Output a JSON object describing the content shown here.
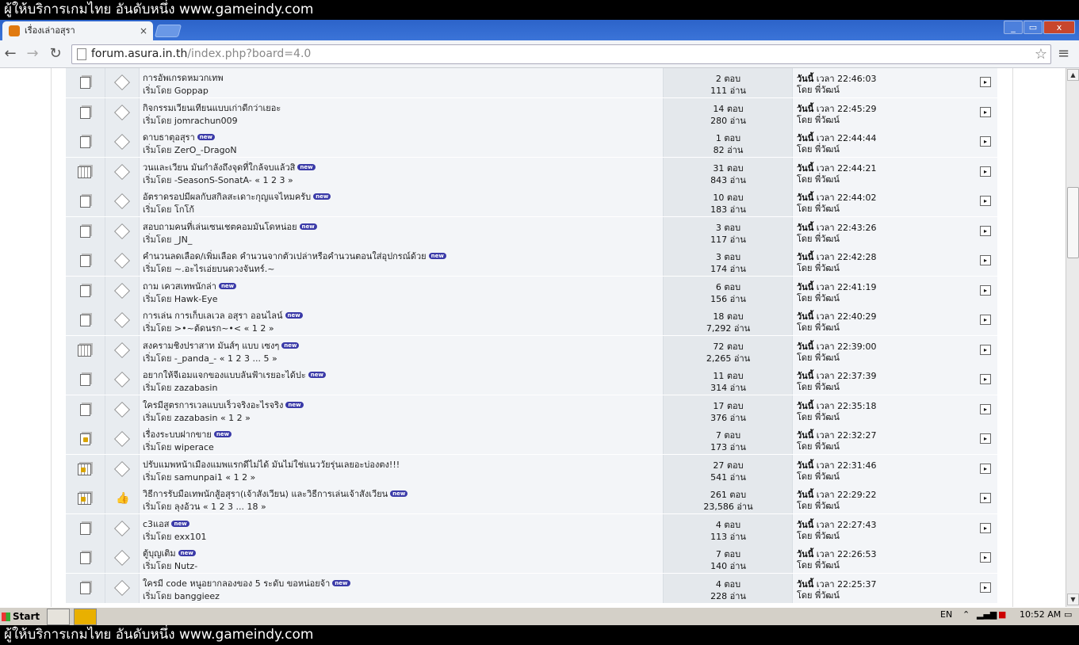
{
  "watermark": {
    "text": "ผู้ให้บริการเกมไทย อันดับหนึ่ง www.gameindy.com"
  },
  "browser": {
    "tab_title": "เรื่องเล่าอสุรา",
    "tab_close": "×",
    "url_host": "forum.asura.in.th",
    "url_path": "/index.php?board=4.0",
    "win_min": "_",
    "win_max": "▭",
    "win_close": "x"
  },
  "colors": {
    "titlebar": "#2c63c9",
    "new_badge": "#3a3aa8"
  },
  "topics": [
    {
      "icon": "normal",
      "mood": "diamond",
      "subject": "การอัพเกรดหมวกเทพ",
      "new": false,
      "starter": "Goppap",
      "pages": "",
      "replies": "2 ตอบ",
      "views": "111 อ่าน",
      "last_time": "22:46:03"
    },
    {
      "icon": "normal",
      "mood": "diamond",
      "subject": "กิจกรรมเวียนเทียนแบบเก่าดีกว่าเยอะ",
      "new": false,
      "starter": "jomrachun009",
      "pages": "",
      "replies": "14 ตอบ",
      "views": "280 อ่าน",
      "last_time": "22:45:29"
    },
    {
      "icon": "normal",
      "mood": "diamond",
      "subject": "ดาบธาตุอสุรา",
      "new": true,
      "starter": "ZerO_-DragoN",
      "pages": "",
      "replies": "1 ตอบ",
      "views": "82 อ่าน",
      "last_time": "22:44:44"
    },
    {
      "icon": "hot",
      "mood": "diamond",
      "subject": "วนและเวียน มันกำลังถึงจุดที่ใกล้จบแล้วสิ",
      "new": true,
      "starter": "-SeasonS-SonatA-",
      "pages": "« 1 2 3 »",
      "replies": "31 ตอบ",
      "views": "843 อ่าน",
      "last_time": "22:44:21"
    },
    {
      "icon": "normal",
      "mood": "diamond",
      "subject": "อัตราดรอปมีผลกับสกิลสะเดาะกุญแจไหมครับ",
      "new": true,
      "starter": "โกโก้",
      "pages": "",
      "replies": "10 ตอบ",
      "views": "183 อ่าน",
      "last_time": "22:44:02"
    },
    {
      "icon": "normal",
      "mood": "diamond",
      "subject": "สอบถามคนที่เล่นเซนเชตคอมมันโดหน่อย",
      "new": true,
      "starter": "_JN_",
      "pages": "",
      "replies": "3 ตอบ",
      "views": "117 อ่าน",
      "last_time": "22:43:26"
    },
    {
      "icon": "normal",
      "mood": "diamond",
      "subject": "คำนวนลดเลือด/เพิ่มเลือด คำนวนจากตัวเปล่าหรือคำนวนตอนใส่อุปกรณ์ด้วย",
      "new": true,
      "starter": "~.อะไรเอ่ยบนดวงจันทร์.~",
      "pages": "",
      "replies": "3 ตอบ",
      "views": "174 อ่าน",
      "last_time": "22:42:28"
    },
    {
      "icon": "normal",
      "mood": "diamond",
      "subject": "ถาม เควสเทพนักล่า",
      "new": true,
      "starter": "Hawk-Eye",
      "pages": "",
      "replies": "6 ตอบ",
      "views": "156 อ่าน",
      "last_time": "22:41:19"
    },
    {
      "icon": "normal",
      "mood": "diamond",
      "subject": "การเล่น การเก็บเลเวล อสุรา ออนไลน์",
      "new": true,
      "starter": ">•~ต้ดนรก~•<",
      "pages": "« 1 2 »",
      "replies": "18 ตอบ",
      "views": "7,292 อ่าน",
      "last_time": "22:40:29"
    },
    {
      "icon": "hot",
      "mood": "diamond",
      "subject": "สงครามชิงปราสาท มันส์ๆ แบบ เซงๆ",
      "new": true,
      "starter": "-_panda_-",
      "pages": "« 1 2 3 ... 5 »",
      "replies": "72 ตอบ",
      "views": "2,265 อ่าน",
      "last_time": "22:39:00"
    },
    {
      "icon": "normal",
      "mood": "diamond",
      "subject": "อยากให้จีเอมแจกของแบบลันฟ้าเรยอะได้ปะ",
      "new": true,
      "starter": "zazabasin",
      "pages": "",
      "replies": "11 ตอบ",
      "views": "314 อ่าน",
      "last_time": "22:37:39"
    },
    {
      "icon": "normal",
      "mood": "diamond",
      "subject": "ใครมีสูตรการเวลแบบเร็วจริงอะไรจริง",
      "new": true,
      "starter": "zazabasin",
      "pages": "« 1 2 »",
      "replies": "17 ตอบ",
      "views": "376 อ่าน",
      "last_time": "22:35:18"
    },
    {
      "icon": "lock",
      "mood": "diamond",
      "subject": "เรื่องระบบฝากขาย",
      "new": true,
      "starter": "wiperace",
      "pages": "",
      "replies": "7 ตอบ",
      "views": "173 อ่าน",
      "last_time": "22:32:27"
    },
    {
      "icon": "hotlock",
      "mood": "diamond",
      "subject": "ปรับแมพหน้าเมืองแมพแรกดีไม่ได้ มันไม่ใช่แนววัยรุ่นเลยอะบ่องตง!!!",
      "new": false,
      "starter": "samunpai1",
      "pages": "« 1 2 »",
      "replies": "27 ตอบ",
      "views": "541 อ่าน",
      "last_time": "22:31:46"
    },
    {
      "icon": "hotlock",
      "mood": "thumb",
      "subject": "วิธีการรับมือเทพนักสู้อสุรา(เจ้าสังเวียน) และวิธีการเล่นเจ้าสังเวียน",
      "new": true,
      "starter": "ลุงอ้วน",
      "pages": "« 1 2 3 ... 18 »",
      "replies": "261 ตอบ",
      "views": "23,586 อ่าน",
      "last_time": "22:29:22"
    },
    {
      "icon": "normal",
      "mood": "diamond",
      "subject": "c3แอส",
      "new": true,
      "starter": "exx101",
      "pages": "",
      "replies": "4 ตอบ",
      "views": "113 อ่าน",
      "last_time": "22:27:43"
    },
    {
      "icon": "normal",
      "mood": "diamond",
      "subject": "ตู้บุญเติม",
      "new": true,
      "starter": "Nutz-",
      "pages": "",
      "replies": "7 ตอบ",
      "views": "140 อ่าน",
      "last_time": "22:26:53"
    },
    {
      "icon": "normal",
      "mood": "diamond",
      "subject": "ใครมี code หนูอยากลองของ 5 ระดับ ขอหน่อยจ้า",
      "new": true,
      "starter": "banggieez",
      "pages": "",
      "replies": "4 ตอบ",
      "views": "228 อ่าน",
      "last_time": "22:25:37"
    }
  ],
  "labels": {
    "started_by": "เริ่มโดย",
    "today": "วันนี้",
    "time_word": "เวลา",
    "by": "โดย",
    "last_poster": "พี่วัฒน์",
    "new_badge": "new"
  },
  "taskbar": {
    "start": "Start",
    "lang": "EN",
    "clock": "10:52 AM"
  }
}
